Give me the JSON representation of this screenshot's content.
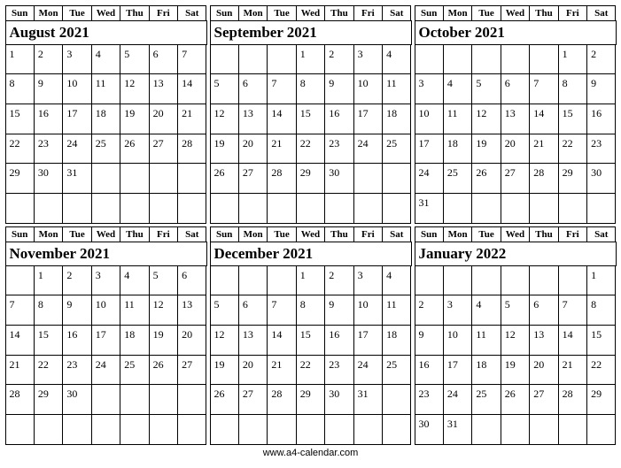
{
  "day_names": [
    "Sun",
    "Mon",
    "Tue",
    "Wed",
    "Thu",
    "Fri",
    "Sat"
  ],
  "months": [
    {
      "title": "August 2021",
      "start": 0,
      "days": 31,
      "rows": 6
    },
    {
      "title": "September 2021",
      "start": 3,
      "days": 30,
      "rows": 6
    },
    {
      "title": "October 2021",
      "start": 5,
      "days": 31,
      "rows": 6
    },
    {
      "title": "November 2021",
      "start": 1,
      "days": 30,
      "rows": 6
    },
    {
      "title": "December 2021",
      "start": 3,
      "days": 31,
      "rows": 6
    },
    {
      "title": "January 2022",
      "start": 6,
      "days": 31,
      "rows": 6
    }
  ],
  "footer": "www.a4-calendar.com"
}
